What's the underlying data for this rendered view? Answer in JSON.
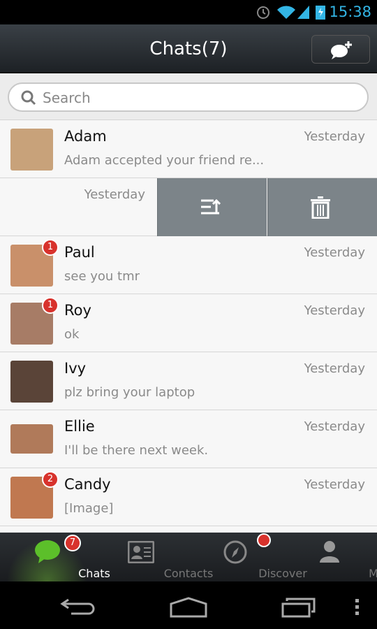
{
  "status": {
    "time": "15:38"
  },
  "header": {
    "title": "Chats(7)",
    "new_chat_icon": "chat-bubble-plus-icon"
  },
  "search": {
    "placeholder": "Search"
  },
  "chats": [
    {
      "name": "Adam",
      "message": "Adam accepted your friend re...",
      "time": "Yesterday",
      "badge": "",
      "color": "#c8a27a"
    },
    {
      "name": "Paul",
      "message": "see you tmr",
      "time": "Yesterday",
      "badge": "1",
      "color": "#c9906a"
    },
    {
      "name": "Roy",
      "message": "ok",
      "time": "Yesterday",
      "badge": "1",
      "color": "#a77c66"
    },
    {
      "name": "Ivy",
      "message": "plz bring your laptop",
      "time": "Yesterday",
      "badge": "",
      "color": "#5a4438"
    },
    {
      "name": "Ellie",
      "message": "I'll be there next week.",
      "time": "Yesterday",
      "badge": "",
      "color": "#b07a5a"
    },
    {
      "name": "Candy",
      "message": "[Image]",
      "time": "Yesterday",
      "badge": "2",
      "color": "#c07850"
    }
  ],
  "swiped_row": {
    "time": "Yesterday",
    "actions": [
      "mark-top-icon",
      "trash-icon"
    ]
  },
  "tabs": [
    {
      "label": "Chats",
      "badge": "7",
      "active": true
    },
    {
      "label": "Contacts"
    },
    {
      "label": "Discover",
      "dot": true
    },
    {
      "label": "Me"
    }
  ],
  "colors": {
    "badge": "#d8322c",
    "accent": "#33b5e5",
    "chats_green": "#5cbf2a"
  }
}
